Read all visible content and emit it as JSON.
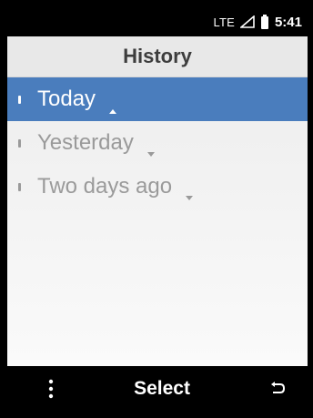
{
  "status_bar": {
    "network": "LTE",
    "time": "5:41",
    "signal_icon": "signal-icon",
    "battery_icon": "battery-icon"
  },
  "header": {
    "title": "History"
  },
  "list": {
    "items": [
      {
        "label": "Today",
        "selected": true,
        "arrow": "up"
      },
      {
        "label": "Yesterday",
        "selected": false,
        "arrow": "down"
      },
      {
        "label": "Two days ago",
        "selected": false,
        "arrow": "down"
      }
    ]
  },
  "softkeys": {
    "left_icon": "menu-icon",
    "center_label": "Select",
    "right_icon": "back-icon"
  },
  "colors": {
    "selected_background": "#4a7dbd",
    "unselected_text": "#9a9a9a",
    "title_text": "#3d3d3d"
  }
}
